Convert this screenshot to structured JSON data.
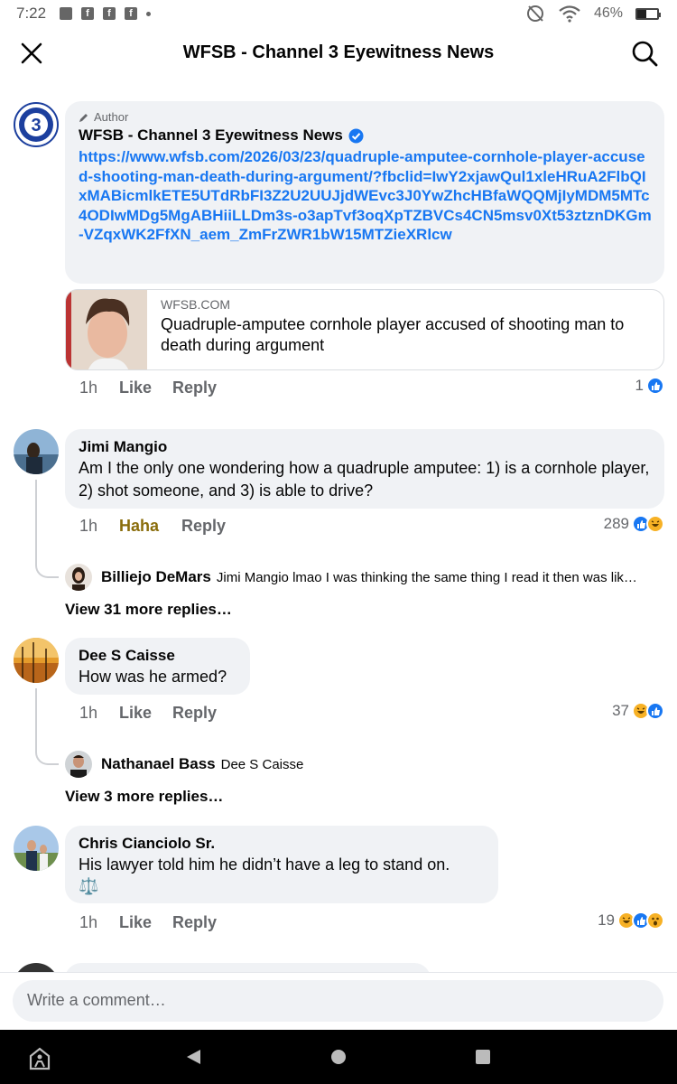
{
  "status_bar": {
    "time": "7:22",
    "battery": "46%"
  },
  "header": {
    "title": "WFSB - Channel 3 Eyewitness News"
  },
  "post_comment": {
    "badge": "Author",
    "name": "WFSB - Channel 3 Eyewitness News",
    "link": "https://www.wfsb.com/2026/03/23/quadruple-amputee-cornhole-player-accused-shooting-man-death-during-argument/?fbclid=IwY2xjawQul1xleHRuA2FlbQIxMABicmlkETE5UTdRbFI3Z2U2UUJjdWEvc3J0YwZhcHBfaWQQMjIyMDM5MTc4ODIwMDg5MgABHiiLLDm3s-o3apTvf3oqXpTZBVCs4CN5msv0Xt53ztznDKGm-VZqxWK2FfXN_aem_ZmFrZWR1bW15MTZieXRlcw",
    "card_domain": "WFSB.COM",
    "card_title": "Quadruple-amputee cornhole player accused of shooting man to death during argument",
    "time": "1h",
    "like_label": "Like",
    "reply_label": "Reply",
    "reaction_count": "1"
  },
  "comments": [
    {
      "name": "Jimi Mangio",
      "text": "Am I the only one wondering how a quadruple amputee: 1) is a cornhole player, 2) shot someone, and 3) is able to drive?",
      "time": "1h",
      "like_label": "Haha",
      "reply_label": "Reply",
      "reaction_count": "289",
      "reply": {
        "name": "Billiejo DeMars",
        "text": "Jimi Mangio lmao I was thinking the same thing I read it then was lik…"
      },
      "view_more": "View 31 more replies…"
    },
    {
      "name": "Dee S Caisse",
      "text": "How was he armed?",
      "time": "1h",
      "like_label": "Like",
      "reply_label": "Reply",
      "reaction_count": "37",
      "reply": {
        "name": "Nathanael Bass",
        "text": "Dee S Caisse"
      },
      "view_more": "View 3 more replies…"
    },
    {
      "name": "Chris Cianciolo Sr.",
      "text": "His lawyer told him he didn’t have a leg to stand on.",
      "emoji": "⚖️",
      "time": "1h",
      "like_label": "Like",
      "reply_label": "Reply",
      "reaction_count": "19"
    }
  ],
  "composer": {
    "placeholder": "Write a comment…"
  },
  "colors": {
    "accent": "#1877f2",
    "haha": "#8a6d0b",
    "bubble": "#f0f2f5"
  }
}
